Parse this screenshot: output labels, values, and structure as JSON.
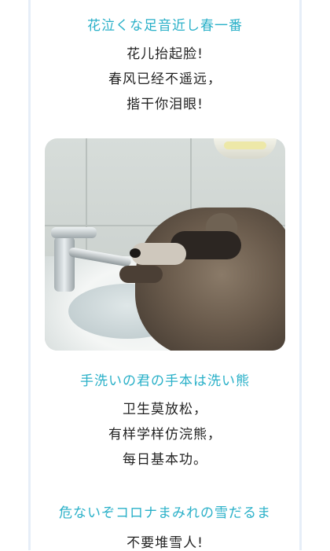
{
  "poem": {
    "verse1": {
      "jp": "花泣くな足音近し春一番",
      "cn": [
        "花儿抬起脸!",
        "春风已经不遥远，",
        "揩干你泪眼!"
      ]
    },
    "verse2": {
      "jp": "手洗いの君の手本は洗い熊",
      "cn": [
        "卫生莫放松，",
        "有样学样仿浣熊，",
        "每日基本功。"
      ]
    },
    "verse3": {
      "jp": "危ないぞコロナまみれの雪だるま",
      "cn": [
        "不要堆雪人!"
      ]
    }
  },
  "colors": {
    "accent": "#29b0c8",
    "text": "#222222"
  }
}
